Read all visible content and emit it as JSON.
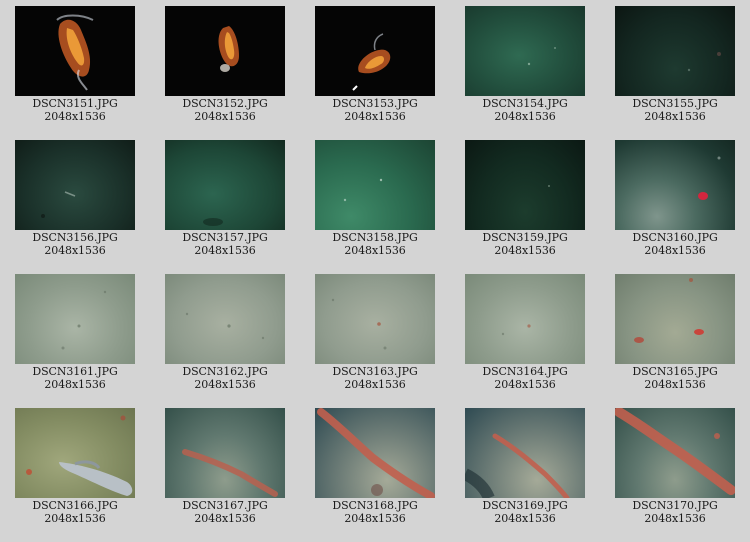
{
  "gallery": {
    "items": [
      {
        "name": "DSCN3151.JPG",
        "dims": "2048x1536"
      },
      {
        "name": "DSCN3152.JPG",
        "dims": "2048x1536"
      },
      {
        "name": "DSCN3153.JPG",
        "dims": "2048x1536"
      },
      {
        "name": "DSCN3154.JPG",
        "dims": "2048x1536"
      },
      {
        "name": "DSCN3155.JPG",
        "dims": "2048x1536"
      },
      {
        "name": "DSCN3156.JPG",
        "dims": "2048x1536"
      },
      {
        "name": "DSCN3157.JPG",
        "dims": "2048x1536"
      },
      {
        "name": "DSCN3158.JPG",
        "dims": "2048x1536"
      },
      {
        "name": "DSCN3159.JPG",
        "dims": "2048x1536"
      },
      {
        "name": "DSCN3160.JPG",
        "dims": "2048x1536"
      },
      {
        "name": "DSCN3161.JPG",
        "dims": "2048x1536"
      },
      {
        "name": "DSCN3162.JPG",
        "dims": "2048x1536"
      },
      {
        "name": "DSCN3163.JPG",
        "dims": "2048x1536"
      },
      {
        "name": "DSCN3164.JPG",
        "dims": "2048x1536"
      },
      {
        "name": "DSCN3165.JPG",
        "dims": "2048x1536"
      },
      {
        "name": "DSCN3166.JPG",
        "dims": "2048x1536"
      },
      {
        "name": "DSCN3167.JPG",
        "dims": "2048x1536"
      },
      {
        "name": "DSCN3168.JPG",
        "dims": "2048x1536"
      },
      {
        "name": "DSCN3169.JPG",
        "dims": "2048x1536"
      },
      {
        "name": "DSCN3170.JPG",
        "dims": "2048x1536"
      }
    ]
  }
}
